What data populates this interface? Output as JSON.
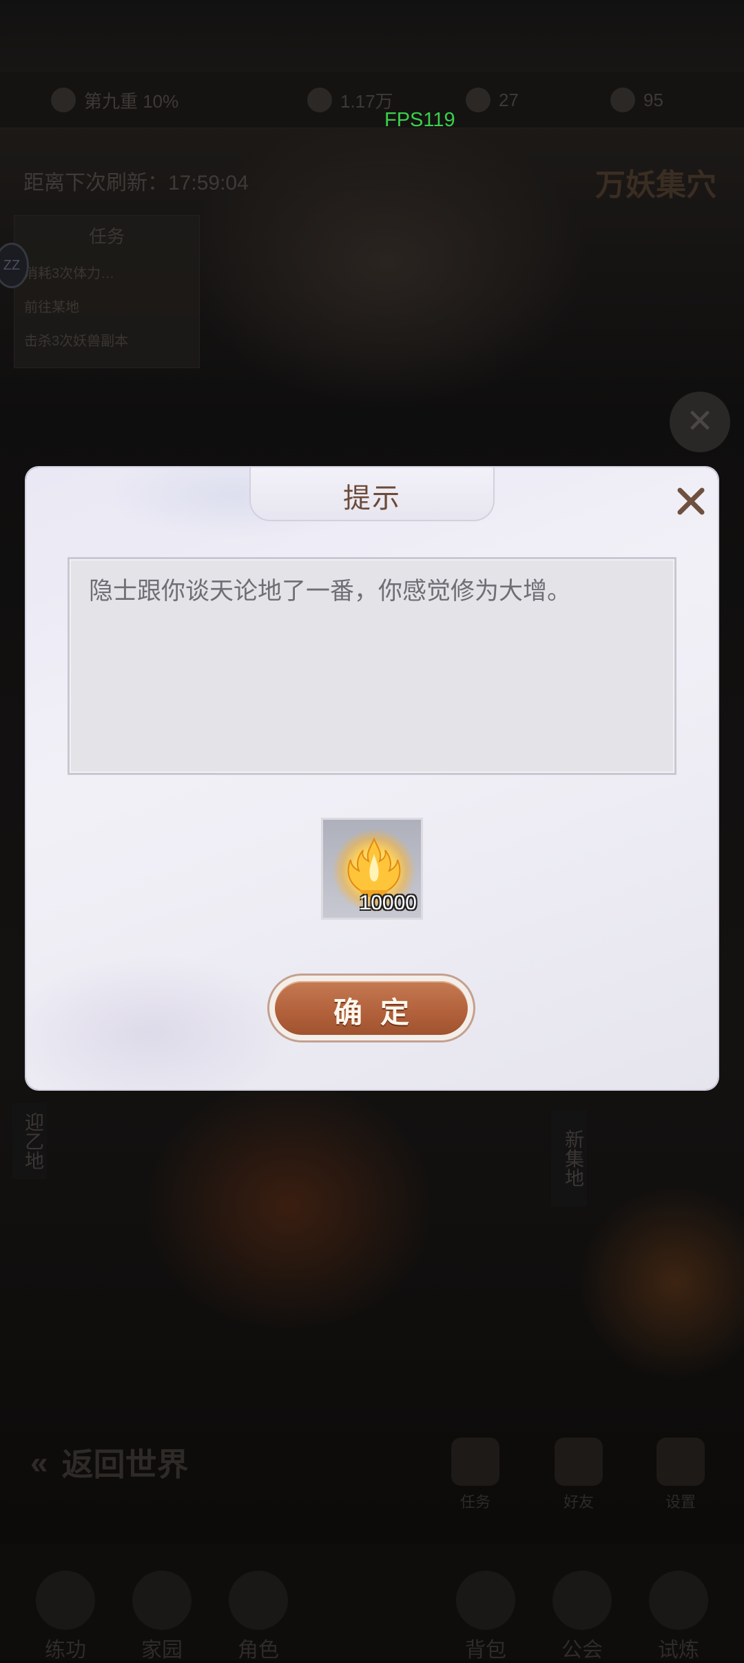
{
  "fps": "FPS119",
  "background": {
    "resources": [
      "第九重 10%",
      "1.17万",
      "27",
      "95"
    ],
    "timer": "距离下次刷新：17:59:04",
    "region_title": "万妖集穴",
    "quest_panel": {
      "title": "任务",
      "items": [
        "消耗3次体力…",
        "前往某地",
        "击杀3次妖兽副本"
      ]
    },
    "avatar_label": "ZZ",
    "side_left": "迎乙地",
    "side_right": "新集地",
    "back_label": "返回世界",
    "quick_actions": [
      "任务",
      "好友",
      "设置"
    ],
    "bottom_nav": [
      "练功",
      "家园",
      "角色",
      "背包",
      "公会",
      "试炼"
    ]
  },
  "dialog": {
    "title": "提示",
    "message": "隐士跟你谈天论地了一番，你感觉修为大增。",
    "reward": {
      "icon": "cultivation-flame-icon",
      "quantity": "10000"
    },
    "confirm_label": "确定"
  },
  "colors": {
    "title_text": "#6b4a38",
    "confirm_button": "#b3623c",
    "fps_text": "#39d14a"
  }
}
